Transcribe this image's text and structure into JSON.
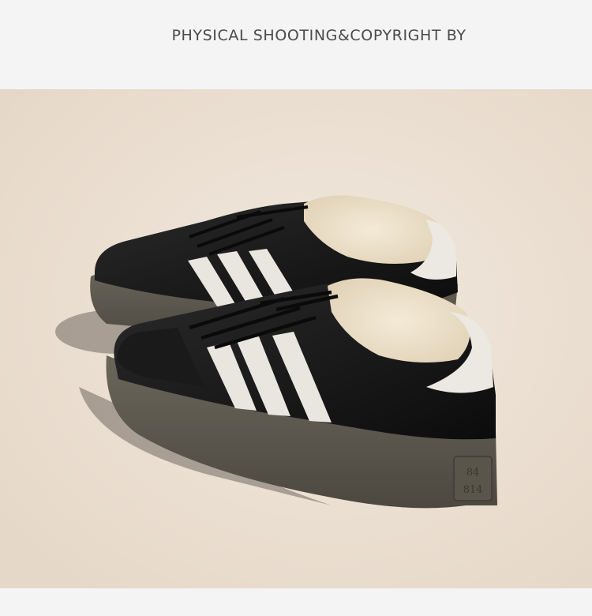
{
  "header": {
    "title": "PHYSICAL SHOOTING&COPYRIGHT BY"
  },
  "photo": {
    "subject": "sneakers",
    "heel_tab_text_line1": "84",
    "heel_tab_text_line2": "814",
    "background_color": "#ede2d6",
    "upper_color": "#151515",
    "stripe_color": "#e9e6e0",
    "sole_color": "#5f5a50",
    "lining_color": "#efe6d4"
  }
}
